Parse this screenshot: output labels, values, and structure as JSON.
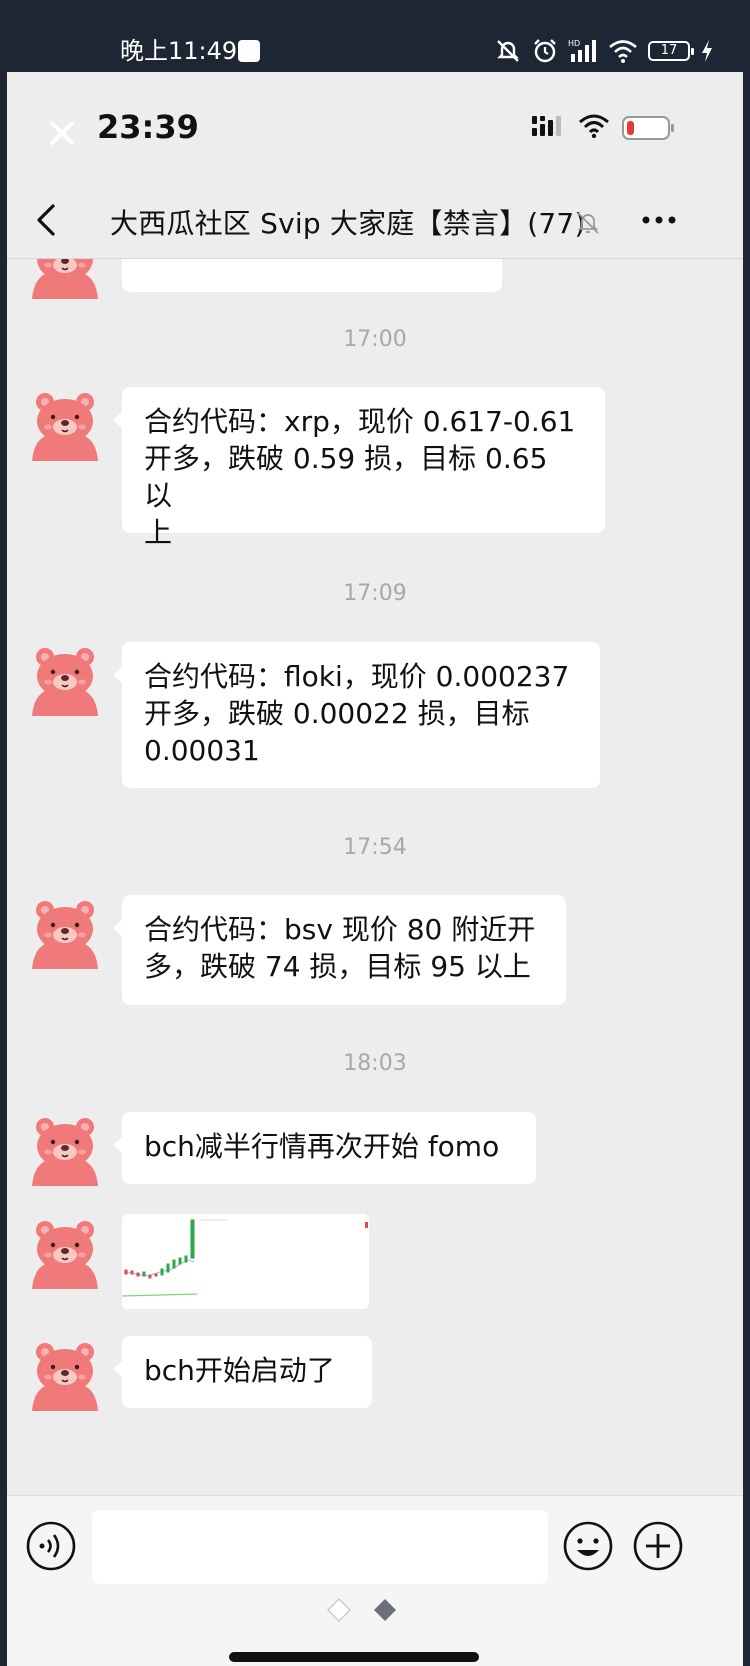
{
  "outer_status": {
    "time": "晚上11:49",
    "battery": "17",
    "icons": [
      "mute-icon",
      "alarm-icon",
      "hd-signal-icon",
      "wifi-icon",
      "battery-icon",
      "charging-icon"
    ]
  },
  "inner_status": {
    "time": "23:39",
    "icons": [
      "close-icon",
      "signal-icon",
      "wifi-icon",
      "battery-low-icon"
    ]
  },
  "nav": {
    "title": "大西瓜社区 Svip 大家庭【禁言】(77)",
    "icons": [
      "back-icon",
      "mute-bell-icon",
      "more-icon"
    ]
  },
  "messages": [
    {
      "type": "timestamp",
      "text": "17:00"
    },
    {
      "type": "text",
      "lines": [
        "合约代码：xrp，现价 0.617-0.61",
        "开多，跌破 0.59 损，目标 0.65 以",
        "上"
      ]
    },
    {
      "type": "timestamp",
      "text": "17:09"
    },
    {
      "type": "text",
      "lines": [
        "合约代码：floki，现价 0.000237",
        "开多，跌破 0.00022 损，目标",
        "0.00031"
      ]
    },
    {
      "type": "timestamp",
      "text": "17:54"
    },
    {
      "type": "text",
      "lines": [
        "合约代码：bsv 现价 80 附近开",
        "多，跌破 74 损，目标 95 以上"
      ]
    },
    {
      "type": "timestamp",
      "text": "18:03"
    },
    {
      "type": "text",
      "lines": [
        "bch减半行情再次开始 fomo"
      ]
    },
    {
      "type": "image",
      "description_icon": "candlestick-chart-icon"
    },
    {
      "type": "text",
      "lines": [
        "bch开始启动了"
      ]
    }
  ],
  "input_bar": {
    "icons": [
      "voice-icon",
      "emoji-icon",
      "plus-icon"
    ],
    "placeholder": ""
  },
  "colors": {
    "outer_bg": "#1e2633",
    "chat_bg": "#ededed",
    "bubble": "#ffffff",
    "avatar_pink": "#f07a7a",
    "timestamp": "#a8a8a8"
  }
}
